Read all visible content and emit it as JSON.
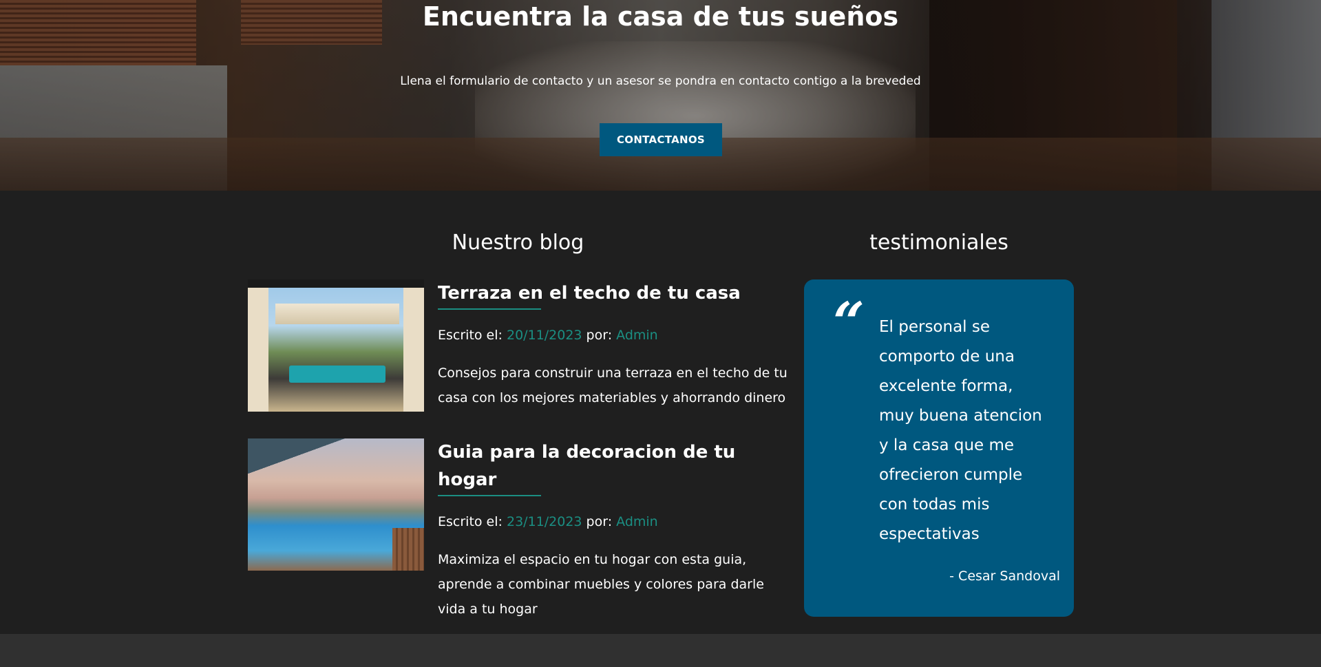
{
  "hero": {
    "title": "Encuentra la casa de tus sueños",
    "subtitle": "Llena el formulario de contacto y un asesor se pondra en contacto contigo a la breveded",
    "cta_label": "CONTACTANOS"
  },
  "blog": {
    "heading": "Nuestro blog",
    "posts": [
      {
        "title": "Terraza en el techo de tu casa",
        "written_label": "Escrito el:",
        "date": "20/11/2023",
        "by_label": "por:",
        "author": "Admin",
        "excerpt": "Consejos para construir una terraza en el techo de tu casa con los mejores materiables y ahorrando dinero"
      },
      {
        "title": "Guia para la decoracion de tu hogar",
        "written_label": "Escrito el:",
        "date": "23/11/2023",
        "by_label": "por:",
        "author": "Admin",
        "excerpt": "Maximiza el espacio en tu hogar con esta guia, aprende a combinar muebles y colores para darle vida a tu hogar"
      }
    ]
  },
  "testimonials": {
    "heading": "testimoniales",
    "quote_mark": "“",
    "quote": "El personal se comporto de una excelente forma, muy buena atencion y la casa que me ofrecieron cumple con todas mis espectativas",
    "author": "- Cesar Sandoval"
  },
  "colors": {
    "primary": "#00587f",
    "accent": "#1b8f83",
    "background": "#1f1f1f",
    "footer": "#303030"
  }
}
